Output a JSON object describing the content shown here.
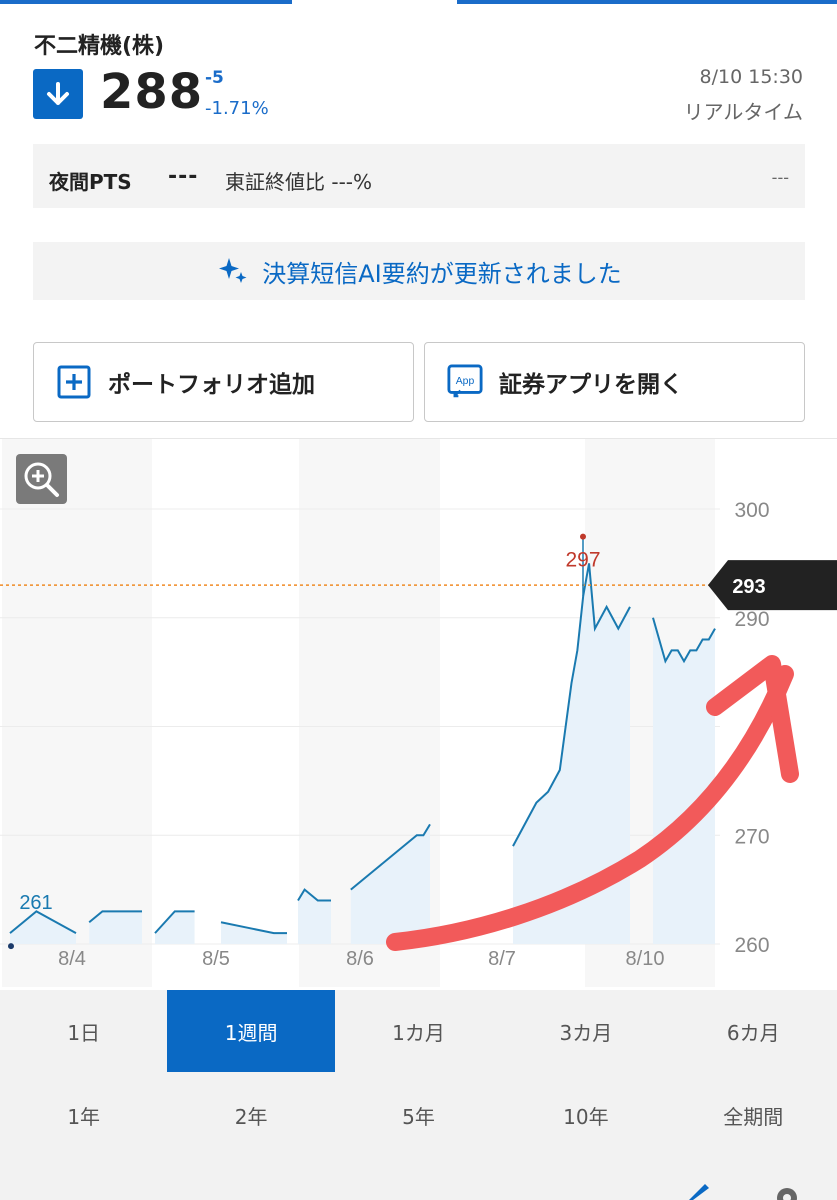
{
  "stock": {
    "name": "不二精機(株)",
    "price": "288",
    "change": "-5",
    "change_pct": "-1.71%",
    "time": "8/10 15:30",
    "realtime_label": "リアルタイム",
    "direction_icon": "arrow-down-icon"
  },
  "pts": {
    "label": "夜間PTS",
    "value": "---",
    "compare": "東証終値比 ---%",
    "right": "---"
  },
  "ai_banner": {
    "text": "決算短信AI要約が更新されました",
    "icon": "sparkle-icon"
  },
  "buttons": {
    "portfolio": "ポートフォリオ追加",
    "app": "証券アプリを開く",
    "app_icon_text": "App"
  },
  "colors": {
    "accent": "#0a69c4",
    "line": "#1a7ab0",
    "high": "#c0392b",
    "ref": "#f08a24",
    "annotation": "#f25a5a"
  },
  "chart_data": {
    "type": "line",
    "y_ticks": [
      "300",
      "290",
      "",
      "270",
      "260"
    ],
    "x_ticks": [
      "8/4",
      "8/5",
      "8/6",
      "8/7",
      "8/10"
    ],
    "ylim": [
      260,
      300
    ],
    "high_label": "297",
    "low_label": "261",
    "ref_label": "293",
    "ref_value": 293,
    "series": [
      {
        "days": [
          {
            "day": "8/4",
            "points": [
              [
                0.0,
                261
              ],
              [
                0.1,
                262
              ],
              [
                0.2,
                263
              ],
              [
                0.35,
                262
              ],
              [
                0.5,
                261
              ],
              [
                0.55,
                null
              ],
              [
                0.6,
                262
              ],
              [
                0.7,
                263
              ],
              [
                0.8,
                263
              ],
              [
                1.0,
                263
              ]
            ]
          },
          {
            "day": "8/5",
            "points": [
              [
                0.0,
                261
              ],
              [
                0.15,
                263
              ],
              [
                0.3,
                263
              ],
              [
                0.35,
                null
              ],
              [
                0.5,
                262
              ],
              [
                0.7,
                261.5
              ],
              [
                0.9,
                261
              ],
              [
                1.0,
                261
              ]
            ]
          },
          {
            "day": "8/6",
            "points": [
              [
                0.0,
                264
              ],
              [
                0.05,
                265
              ],
              [
                0.15,
                264
              ],
              [
                0.25,
                264
              ],
              [
                0.3,
                null
              ],
              [
                0.4,
                265
              ],
              [
                0.5,
                266
              ],
              [
                0.6,
                267
              ],
              [
                0.7,
                268
              ],
              [
                0.8,
                269
              ],
              [
                0.9,
                270
              ],
              [
                0.95,
                270
              ],
              [
                1.0,
                271
              ]
            ]
          },
          {
            "day": "8/7",
            "points": [
              [
                0.0,
                269
              ],
              [
                0.1,
                271
              ],
              [
                0.2,
                273
              ],
              [
                0.3,
                274
              ],
              [
                0.4,
                276
              ],
              [
                0.5,
                284
              ],
              [
                0.55,
                287
              ],
              [
                0.6,
                292
              ],
              [
                0.65,
                295
              ],
              [
                0.7,
                289
              ],
              [
                0.8,
                291
              ],
              [
                0.9,
                289
              ],
              [
                1.0,
                291
              ]
            ]
          },
          {
            "day": "8/10",
            "points": [
              [
                0.0,
                290
              ],
              [
                0.1,
                288
              ],
              [
                0.2,
                286
              ],
              [
                0.3,
                287
              ],
              [
                0.4,
                287
              ],
              [
                0.5,
                286
              ],
              [
                0.6,
                287
              ],
              [
                0.7,
                287
              ],
              [
                0.8,
                288
              ],
              [
                0.9,
                288
              ],
              [
                1.0,
                289
              ]
            ]
          }
        ]
      }
    ]
  },
  "tabs": [
    "1日",
    "1週間",
    "1カ月",
    "3カ月",
    "6カ月",
    "1年",
    "2年",
    "5年",
    "10年",
    "全期間"
  ],
  "active_tab": "1週間"
}
